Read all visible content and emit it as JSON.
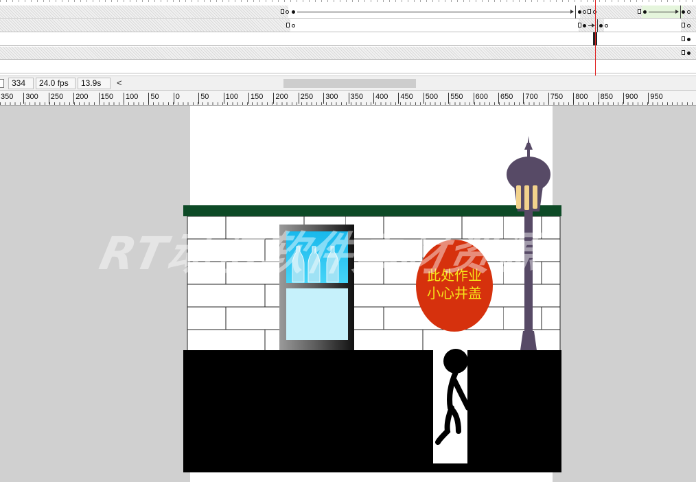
{
  "status_bar": {
    "frame": "334",
    "fps": "24.0 fps",
    "time": "13.9s",
    "scroll_left_icon": "<"
  },
  "ruler": {
    "labels": [
      "350",
      "300",
      "250",
      "200",
      "150",
      "100",
      "50",
      "0",
      "50",
      "100",
      "150",
      "200",
      "250",
      "300",
      "350",
      "400",
      "450",
      "500",
      "550",
      "600",
      "650",
      "700",
      "750",
      "800",
      "850",
      "900",
      "950"
    ]
  },
  "scene": {
    "sign_line1": "此处作业",
    "sign_line2": "小心井盖",
    "watermark": "RT动漫软件素材资源",
    "colors": {
      "roof": "#0d4a26",
      "sign": "#d6310d",
      "sign_text": "#f6e21a",
      "lamp": "#574a66",
      "lamp_glow": "#f2d28c",
      "cooler_glass": "#2ec7f0"
    }
  },
  "icons": {
    "keyframe": "hollow-rect",
    "playhead": "red-line"
  }
}
